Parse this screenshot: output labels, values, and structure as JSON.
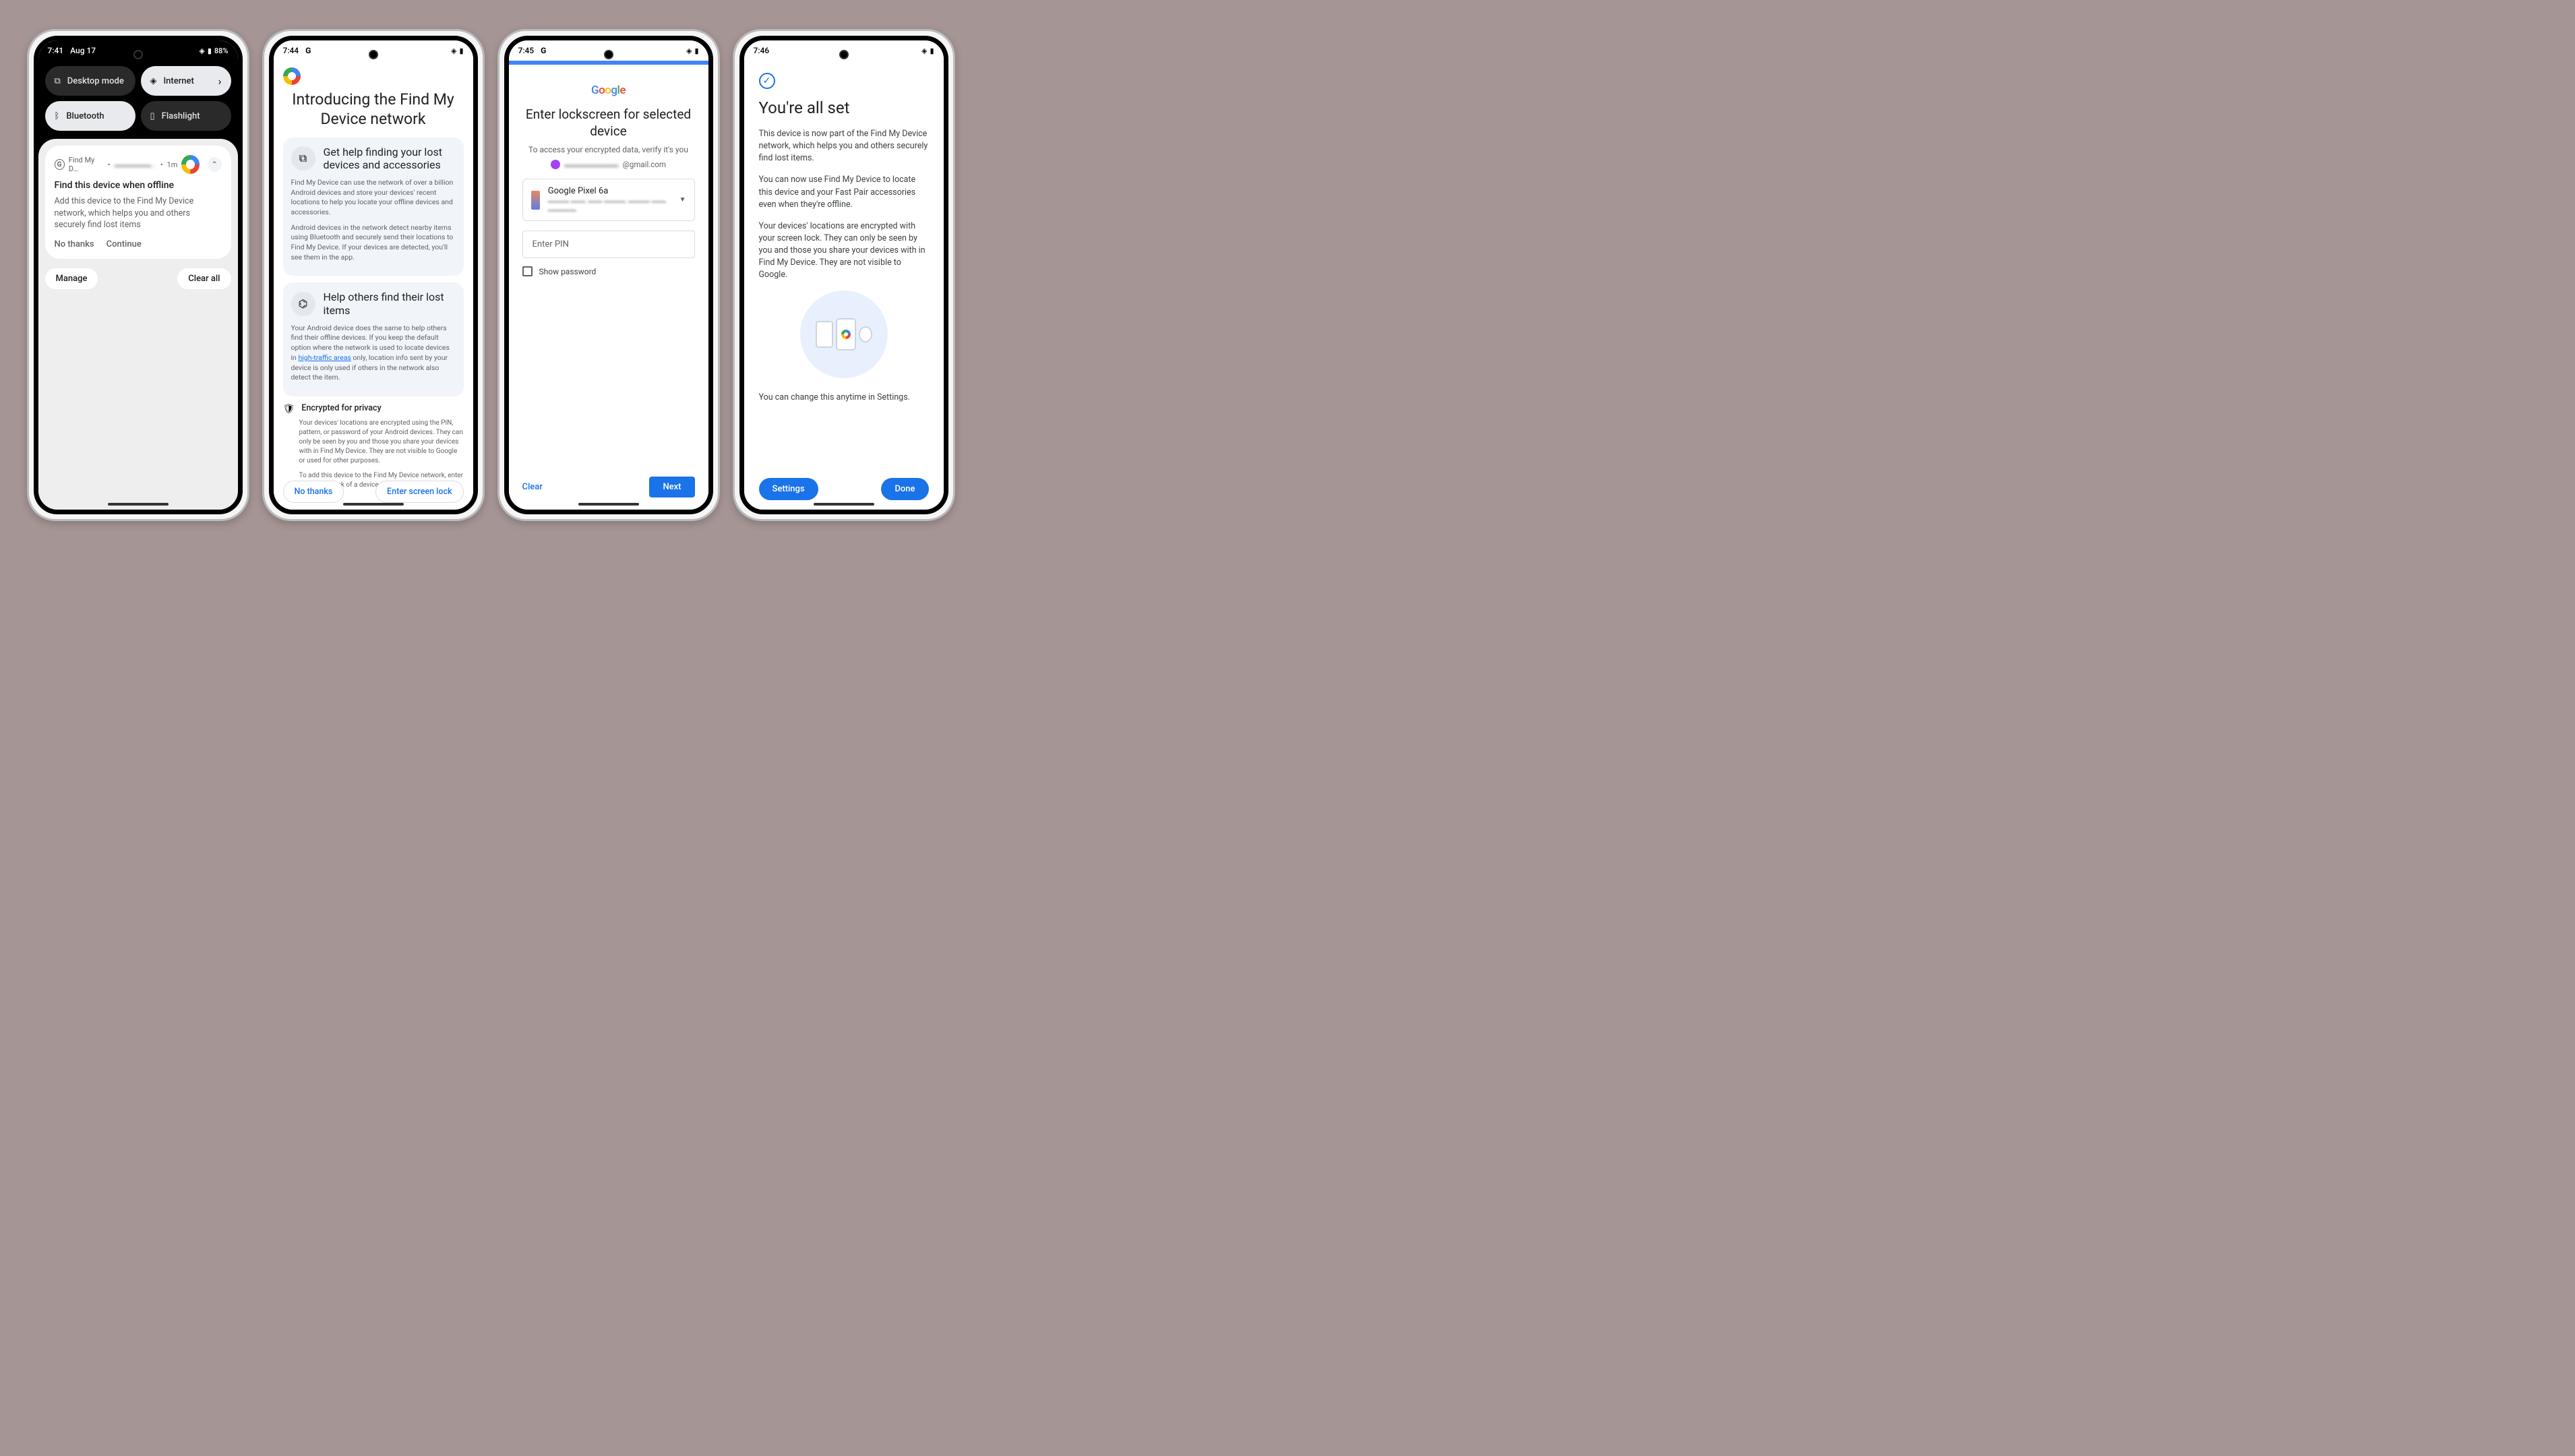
{
  "phone1": {
    "status": {
      "time": "7:41",
      "date": "Aug 17",
      "battery": "88%"
    },
    "tiles": {
      "desktop": "Desktop mode",
      "internet": "Internet",
      "bluetooth": "Bluetooth",
      "flashlight": "Flashlight"
    },
    "notification": {
      "app": "Find My D…",
      "sender": "▬▬▬▬▬…",
      "age": "1m",
      "title": "Find this device when offline",
      "body": "Add this device to the Find My Device network, which helps you and others securely find lost items",
      "action_no": "No thanks",
      "action_yes": "Continue"
    },
    "footer": {
      "manage": "Manage",
      "clear": "Clear all"
    }
  },
  "phone2": {
    "status": {
      "time": "7:44"
    },
    "title": "Introducing the Find My Device network",
    "card1": {
      "title": "Get help finding your lost devices and accessories",
      "p1": "Find My Device can use the network of over a billion Android devices and store your devices' recent locations to help you locate your offline devices and accessories.",
      "p2": "Android devices in the network detect nearby items using Bluetooth and securely send their locations to Find My Device. If your devices are detected, you'll see them in the app."
    },
    "card2": {
      "title": "Help others find their lost items",
      "p1_a": "Your Android device does the same to help others find their offline devices. If you keep the default option where the network is used to locate devices in ",
      "link": "high-traffic areas",
      "p1_b": " only, location info sent by your device is only used if others in the network also detect the item."
    },
    "privacy": {
      "heading": "Encrypted for privacy",
      "p1": "Your devices' locations are encrypted using the PIN, pattern, or password of your Android devices. They can only be seen by you and those you share your devices with in Find My Device. They are not visible to Google or used for other purposes.",
      "p2": "To add this device to the Find My Device network, enter the screen lock of a device that's already added to the network."
    },
    "footer": {
      "no": "No thanks",
      "enter": "Enter screen lock"
    }
  },
  "phone3": {
    "status": {
      "time": "7:45"
    },
    "title": "Enter lockscreen for selected device",
    "subtitle": "To access your encrypted data, verify it's you",
    "email_masked": "▬▬▬▬▬▬▬",
    "email_domain": "@gmail.com",
    "device": {
      "name": "Google Pixel 6a",
      "meta": "▬▬▬ ▬▬, ▬▬ ▬▬▬, ▬▬▬ ▬▬, ▬▬▬▬"
    },
    "pin_placeholder": "Enter PIN",
    "show_pw": "Show password",
    "footer": {
      "clear": "Clear",
      "next": "Next"
    }
  },
  "phone4": {
    "status": {
      "time": "7:46"
    },
    "title": "You're all set",
    "p1": "This device is now part of the Find My Device network, which helps you and others securely find lost items.",
    "p2": "You can now use Find My Device to locate this device and your Fast Pair accessories even when they're offline.",
    "p3": "Your devices' locations are encrypted with your screen lock. They can only be seen by you and those you share your devices with in Find My Device. They are not visible to Google.",
    "note": "You can change this anytime in Settings.",
    "footer": {
      "settings": "Settings",
      "done": "Done"
    }
  }
}
